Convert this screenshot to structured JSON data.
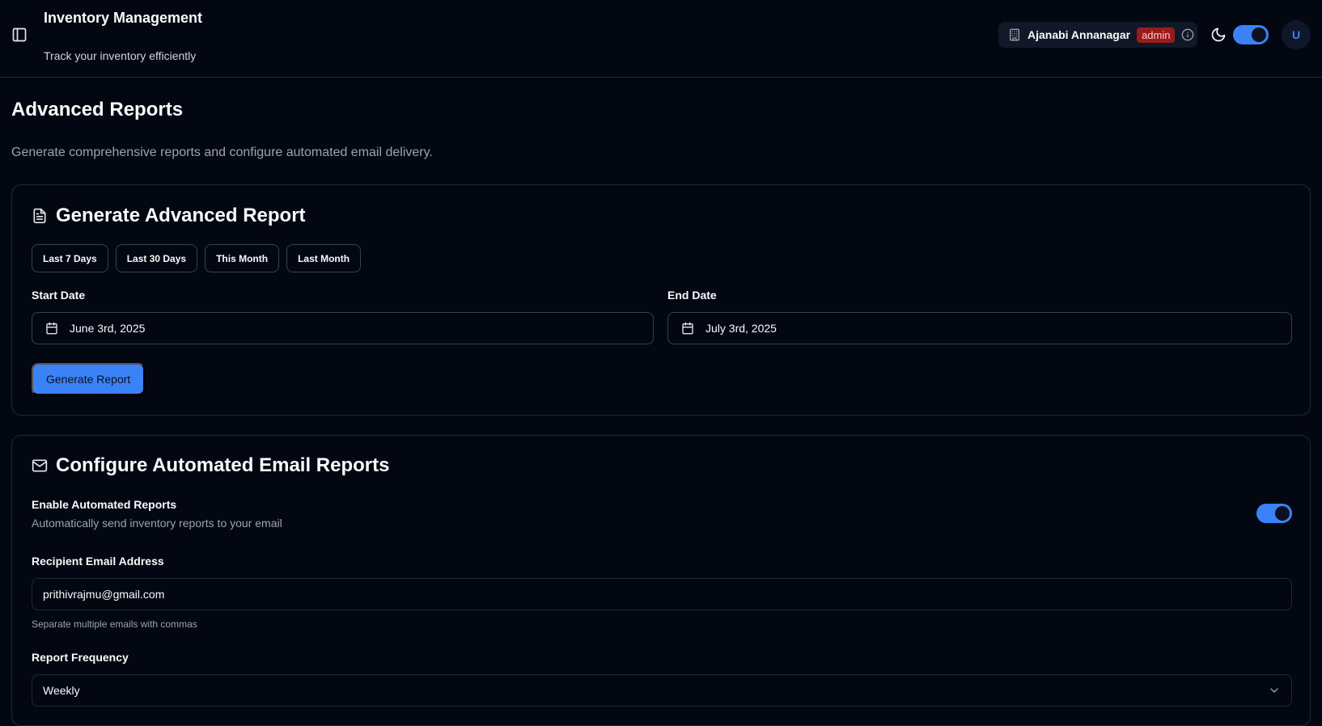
{
  "header": {
    "title": "Inventory Management",
    "subtitle": "Track your inventory efficiently",
    "store_name": "Ajanabi Annanagar",
    "role_badge": "admin",
    "avatar_initial": "U"
  },
  "page": {
    "title": "Advanced Reports",
    "description": "Generate comprehensive reports and configure automated email delivery."
  },
  "report_card": {
    "title": "Generate Advanced Report",
    "presets": [
      "Last 7 Days",
      "Last 30 Days",
      "This Month",
      "Last Month"
    ],
    "start_label": "Start Date",
    "start_value": "June 3rd, 2025",
    "end_label": "End Date",
    "end_value": "July 3rd, 2025",
    "generate_label": "Generate Report"
  },
  "email_card": {
    "title": "Configure Automated Email Reports",
    "enable_label": "Enable Automated Reports",
    "enable_desc": "Automatically send inventory reports to your email",
    "enabled": true,
    "email_label": "Recipient Email Address",
    "email_value": "prithivrajmu@gmail.com",
    "email_hint": "Separate multiple emails with commas",
    "frequency_label": "Report Frequency",
    "frequency_value": "Weekly"
  },
  "theme": {
    "dark_mode": true,
    "accent": "#3b82f6",
    "badge_bg": "#991b1b"
  },
  "icons": {
    "sidebar_toggle": "panel-left-icon",
    "store": "building-icon",
    "info": "info-icon",
    "theme": "moon-icon",
    "report": "file-text-icon",
    "calendar": "calendar-icon",
    "email": "mail-icon",
    "dropdown": "chevron-down-icon"
  }
}
